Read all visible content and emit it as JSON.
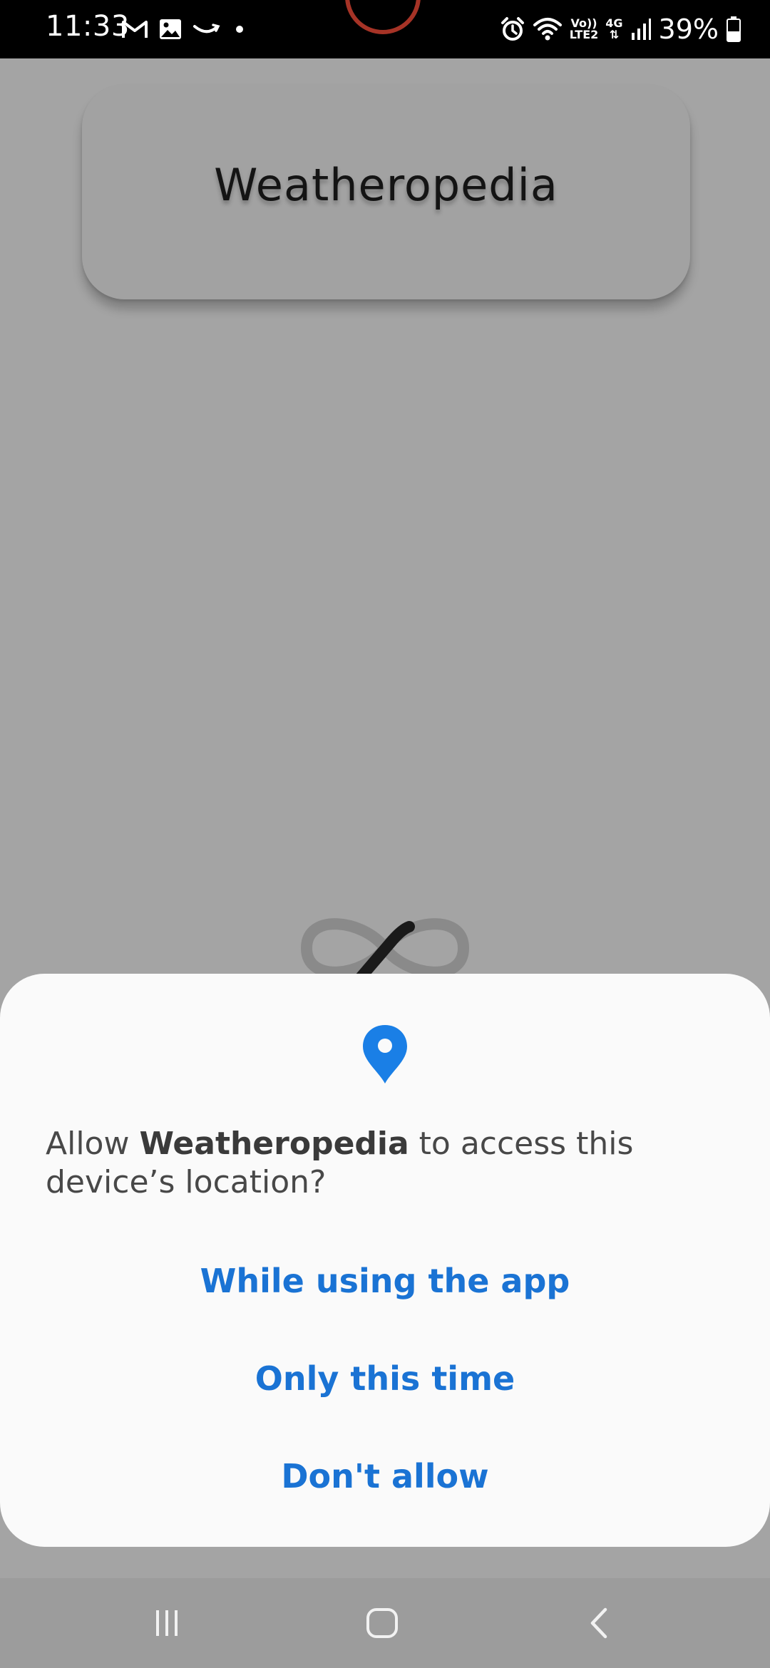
{
  "status_bar": {
    "time": "11:33",
    "left_icons": [
      "gmail-icon",
      "gallery-icon",
      "amazon-icon",
      "dot-icon"
    ],
    "network_top": "Vo))",
    "network_bottom": "LTE2",
    "network_type": "4G",
    "battery_percent": "39%",
    "right_icons": [
      "alarm-icon",
      "wifi-icon",
      "signal-icon",
      "battery-icon"
    ]
  },
  "app": {
    "title": "Weatheropedia"
  },
  "dialog": {
    "icon": "location-pin-icon",
    "message_prefix": "Allow ",
    "app_name": "Weatheropedia",
    "message_suffix": " to access this device’s location?",
    "buttons": {
      "while_using": "While using the app",
      "only_this_time": "Only this time",
      "dont_allow": "Don't allow"
    }
  },
  "nav_bar": {
    "buttons": [
      "recent-apps-icon",
      "home-icon",
      "back-icon"
    ]
  },
  "colors": {
    "accent": "#1a73d4",
    "pin": "#1a7fe6",
    "scrim_background": "#a4a4a4",
    "dialog_background": "#fafafa"
  }
}
